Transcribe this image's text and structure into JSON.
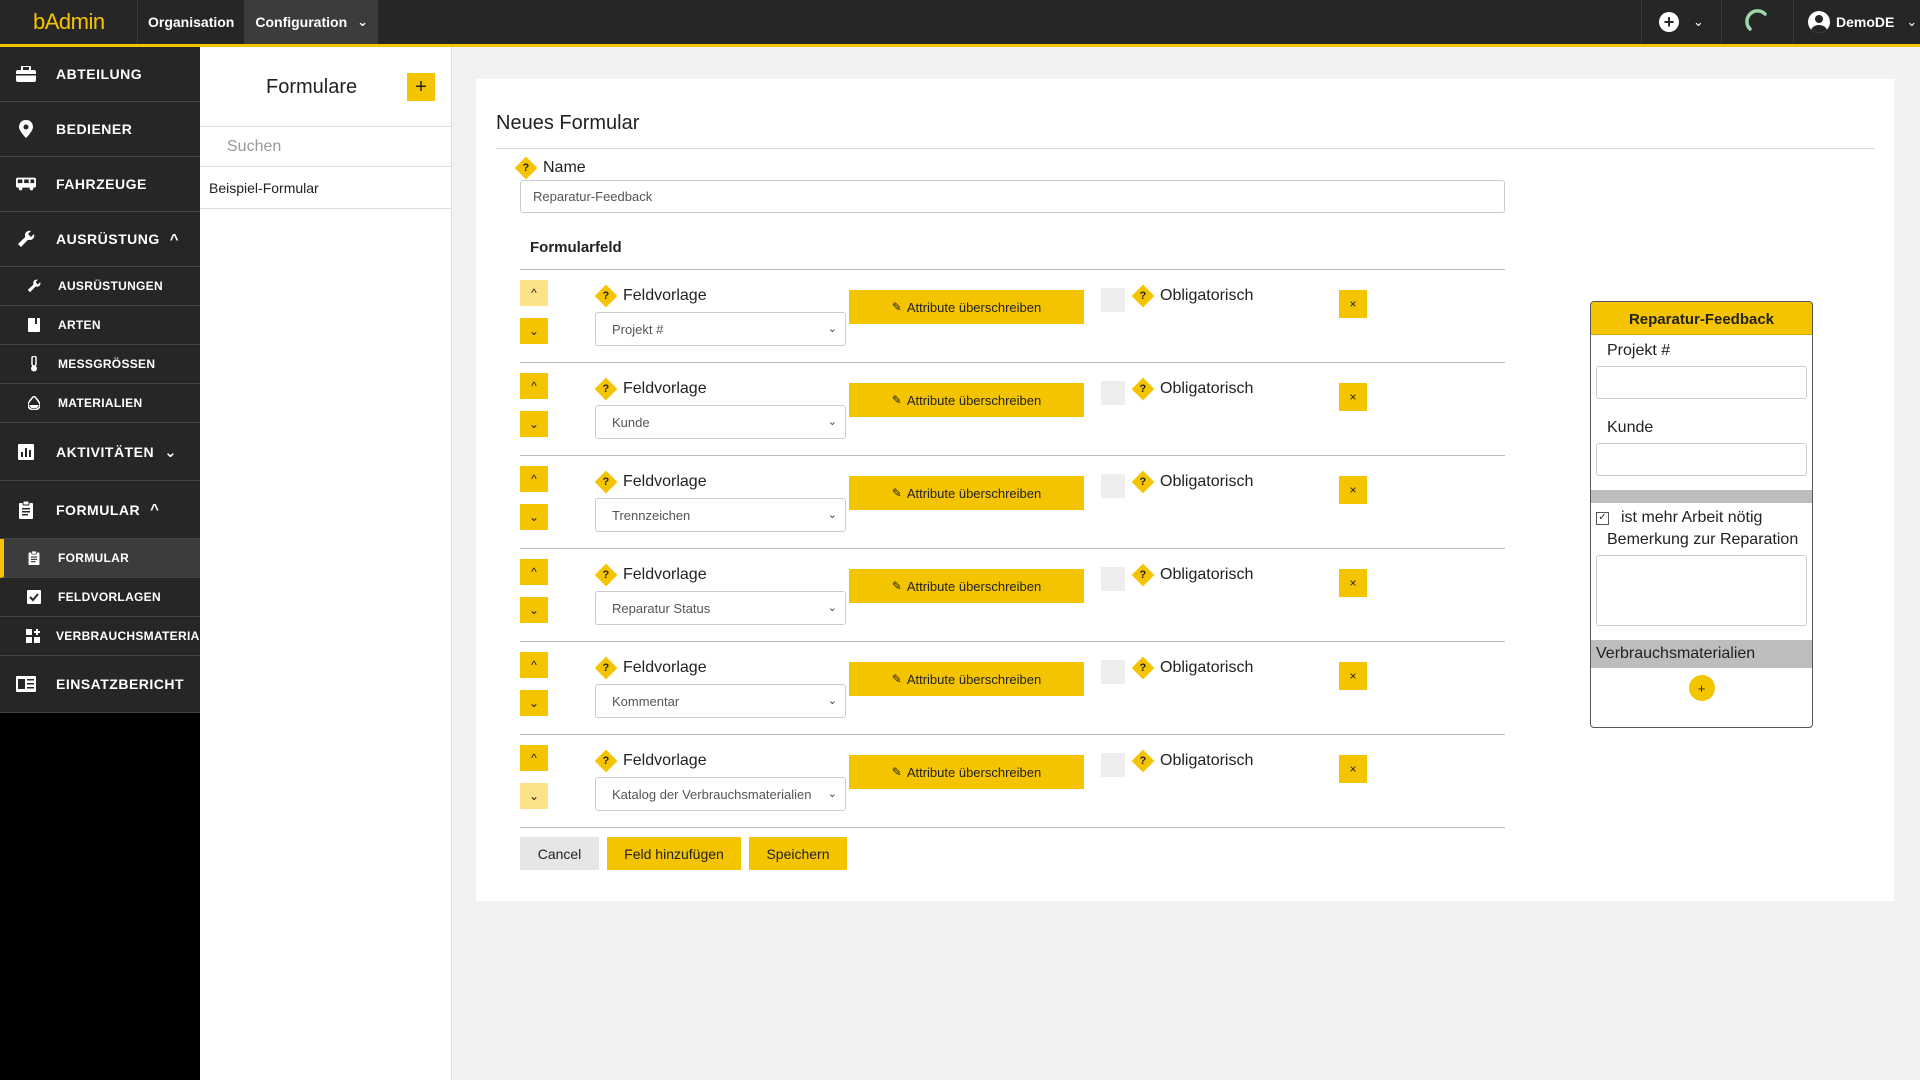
{
  "topbar": {
    "brand": "bAdmin",
    "nav": [
      {
        "label": "Organisation",
        "active": false
      },
      {
        "label": "Configuration",
        "active": true
      }
    ],
    "user": "DemoDE"
  },
  "sidebar": {
    "items": [
      {
        "label": "ABTEILUNG",
        "icon": "briefcase-icon",
        "type": "main"
      },
      {
        "label": "BEDIENER",
        "icon": "location-pin-icon",
        "type": "main"
      },
      {
        "label": "FAHRZEUGE",
        "icon": "bus-icon",
        "type": "main"
      },
      {
        "label": "AUSRÜSTUNG",
        "icon": "wrench-icon",
        "type": "main",
        "chevron": "up"
      },
      {
        "label": "AUSRÜSTUNGEN",
        "icon": "wrench-icon",
        "type": "sub"
      },
      {
        "label": "ARTEN",
        "icon": "book-icon",
        "type": "sub"
      },
      {
        "label": "MESSGRÖSSEN",
        "icon": "thermometer-icon",
        "type": "sub"
      },
      {
        "label": "MATERIALIEN",
        "icon": "drop-icon",
        "type": "sub"
      },
      {
        "label": "AKTIVITÄTEN",
        "icon": "bar-chart-icon",
        "type": "main",
        "chevron": "down"
      },
      {
        "label": "FORMULAR",
        "icon": "clipboard-icon",
        "type": "main",
        "chevron": "up"
      },
      {
        "label": "FORMULAR",
        "icon": "clipboard-icon",
        "type": "sub",
        "active": true
      },
      {
        "label": "FELDVORLAGEN",
        "icon": "checkbox-icon",
        "type": "sub"
      },
      {
        "label": "VERBRAUCHSMATERIALIEN",
        "icon": "grid-plus-icon",
        "type": "sub"
      },
      {
        "label": "EINSATZBERICHT",
        "icon": "report-icon",
        "type": "main"
      }
    ]
  },
  "forms_panel": {
    "title": "Formulare",
    "search_placeholder": "Suchen",
    "items": [
      "Beispiel-Formular"
    ]
  },
  "form": {
    "title": "Neues Formular",
    "name_label": "Name",
    "name_value": "Reparatur-Feedback",
    "formularfeld_label": "Formularfeld",
    "feldvorlage_label": "Feldvorlage",
    "override_label": "Attribute überschreiben",
    "obligatorisch_label": "Obligatorisch",
    "fields": [
      {
        "value": "Projekt #"
      },
      {
        "value": "Kunde"
      },
      {
        "value": "Trennzeichen"
      },
      {
        "value": "Reparatur Status"
      },
      {
        "value": "Kommentar"
      },
      {
        "value": "Katalog der Verbrauchsmaterialien"
      }
    ],
    "buttons": {
      "cancel": "Cancel",
      "add_field": "Feld hinzufügen",
      "save": "Speichern"
    }
  },
  "preview": {
    "title": "Reparatur-Feedback",
    "fields": [
      "Projekt #",
      "Kunde"
    ],
    "checkbox_label": "ist mehr Arbeit nötig",
    "checkbox_checked": true,
    "textarea_label": "Bemerkung zur Reparation",
    "section_label": "Verbrauchsmaterialien"
  },
  "colors": {
    "accent": "#f5c400",
    "topbar": "#262626",
    "sidebar": "#262626"
  }
}
